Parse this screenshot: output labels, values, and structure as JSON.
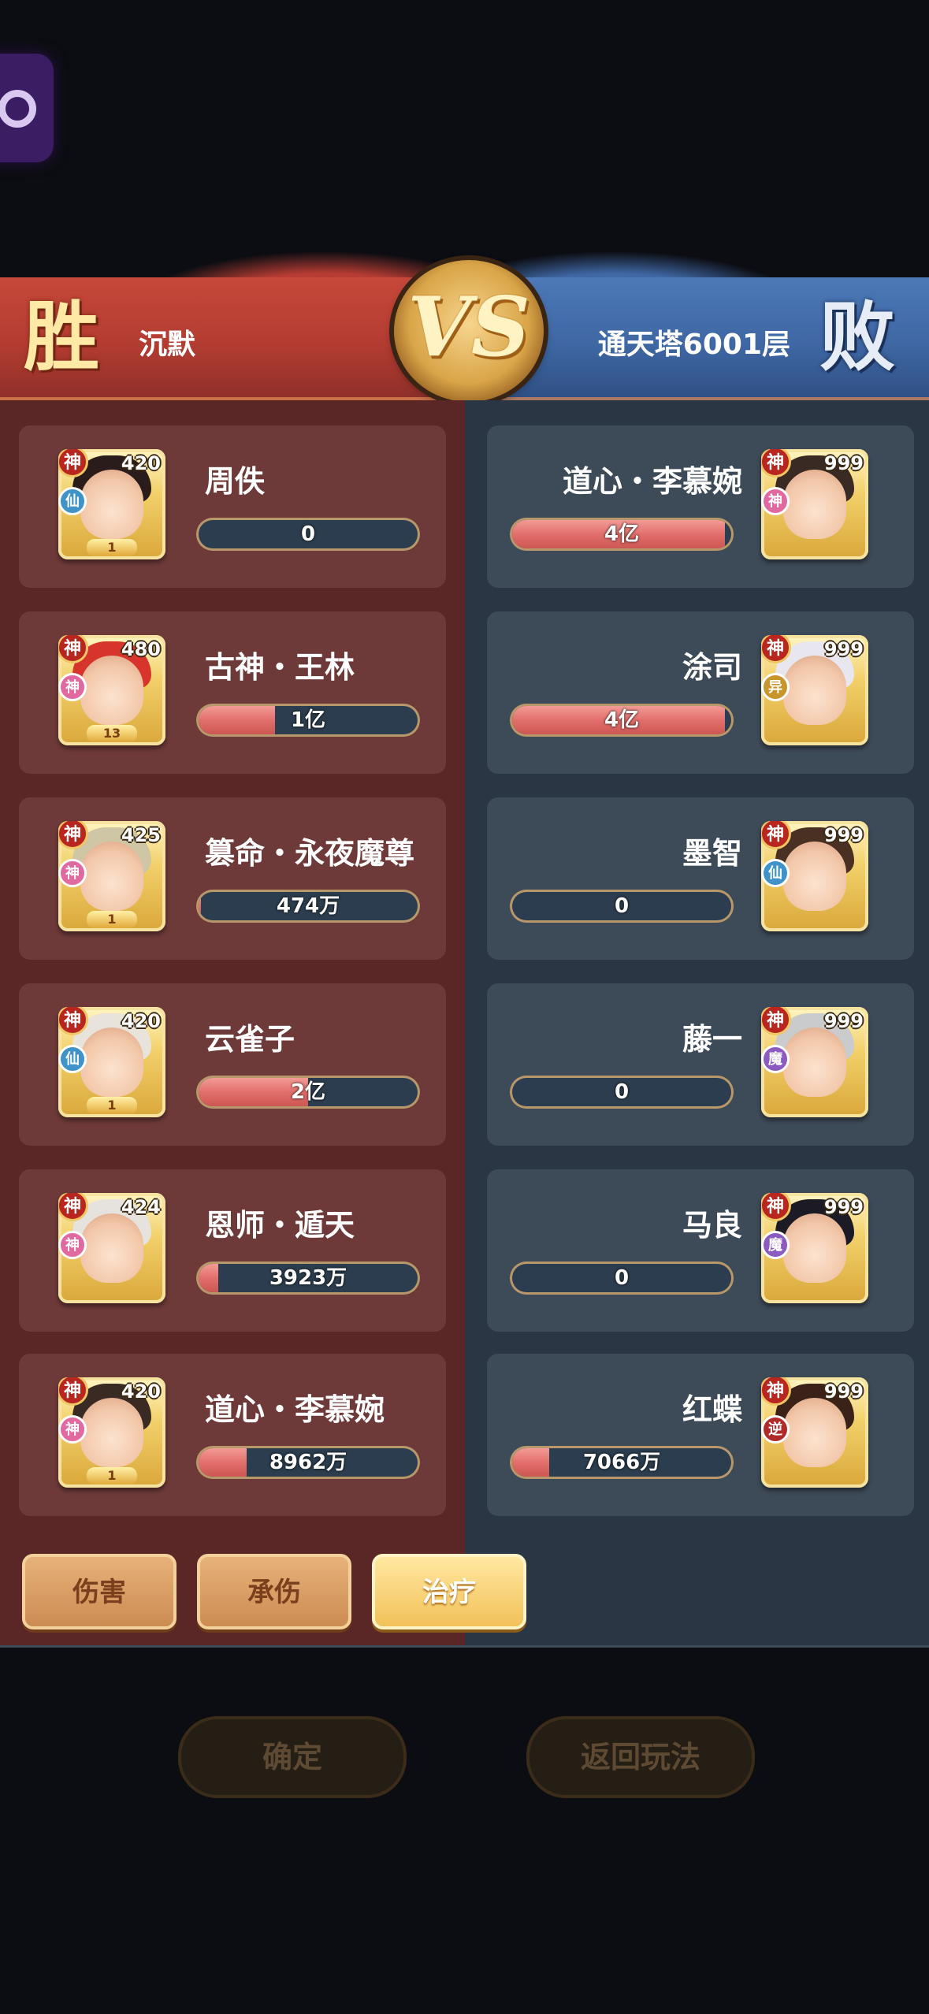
{
  "header": {
    "result_left": "胜",
    "result_right": "败",
    "player_left": "沉默",
    "player_right": "通天塔6001层",
    "vs_label": "VS"
  },
  "left_team": [
    {
      "name": "周佚",
      "level": "420",
      "race": "仙",
      "race_color": "#3f93c9",
      "star": "1",
      "bar_fill": 0.0,
      "bar_label": "0",
      "hair_color": "#2a1c1a"
    },
    {
      "name": "古神・王林",
      "level": "480",
      "race": "神",
      "race_color": "#e06aa0",
      "star": "13",
      "bar_fill": 0.35,
      "bar_label": "1亿",
      "hair_color": "#d7352c"
    },
    {
      "name": "篡命・永夜魔尊",
      "level": "425",
      "race": "神",
      "race_color": "#e06aa0",
      "star": "1",
      "bar_fill": 0.01,
      "bar_label": "474万",
      "hair_color": "#cfc6a6"
    },
    {
      "name": "云雀子",
      "level": "420",
      "race": "仙",
      "race_color": "#3f93c9",
      "star": "1",
      "bar_fill": 0.5,
      "bar_label": "2亿",
      "hair_color": "#e8e4dc"
    },
    {
      "name": "恩师・遁天",
      "level": "424",
      "race": "神",
      "race_color": "#e06aa0",
      "star": "",
      "bar_fill": 0.09,
      "bar_label": "3923万",
      "hair_color": "#e6e2de"
    },
    {
      "name": "道心・李慕婉",
      "level": "420",
      "race": "神",
      "race_color": "#e06aa0",
      "star": "1",
      "bar_fill": 0.22,
      "bar_label": "8962万",
      "hair_color": "#3a2a24"
    }
  ],
  "right_team": [
    {
      "name": "道心・李慕婉",
      "level": "999",
      "race": "神",
      "race_color": "#e06aa0",
      "bar_fill": 0.97,
      "bar_label": "4亿",
      "hair_color": "#3a2a24"
    },
    {
      "name": "涂司",
      "level": "999",
      "race": "异",
      "race_color": "#c9952a",
      "bar_fill": 0.97,
      "bar_label": "4亿",
      "hair_color": "#e8e6ee"
    },
    {
      "name": "墨智",
      "level": "999",
      "race": "仙",
      "race_color": "#3f93c9",
      "bar_fill": 0.0,
      "bar_label": "0",
      "hair_color": "#4a3022"
    },
    {
      "name": "藤一",
      "level": "999",
      "race": "魔",
      "race_color": "#8b5bc2",
      "bar_fill": 0.0,
      "bar_label": "0",
      "hair_color": "#c9cbcc"
    },
    {
      "name": "马良",
      "level": "999",
      "race": "魔",
      "race_color": "#8b5bc2",
      "bar_fill": 0.0,
      "bar_label": "0",
      "hair_color": "#1c1a24"
    },
    {
      "name": "红蝶",
      "level": "999",
      "race": "逆",
      "race_color": "#b02a2a",
      "bar_fill": 0.17,
      "bar_label": "7066万",
      "hair_color": "#3a2218"
    }
  ],
  "badge_god_label": "神",
  "tabs": [
    {
      "label": "伤害",
      "active": false
    },
    {
      "label": "承伤",
      "active": false
    },
    {
      "label": "治疗",
      "active": true
    }
  ],
  "footer": {
    "confirm_label": "确定",
    "return_label": "返回玩法"
  }
}
